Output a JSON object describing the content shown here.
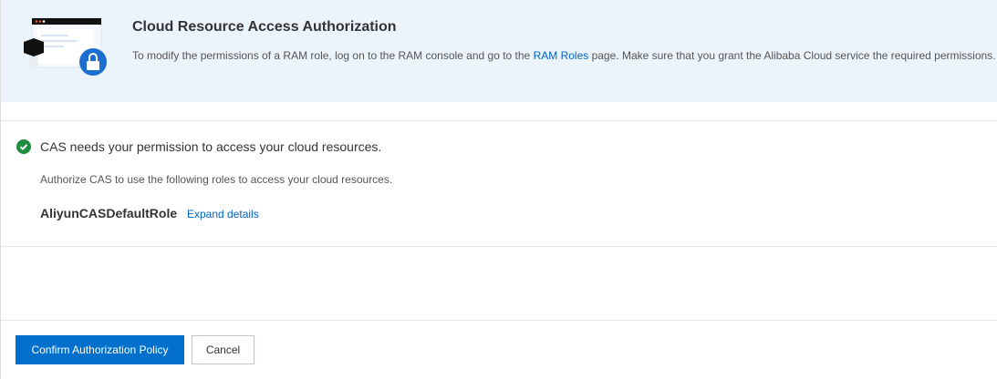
{
  "banner": {
    "title": "Cloud Resource Access Authorization",
    "desc_before": "To modify the permissions of a RAM role, log on to the RAM console and go to the ",
    "link": "RAM Roles",
    "desc_after": " page. Make sure that you grant the Alibaba Cloud service the required permissions."
  },
  "main": {
    "message": "CAS needs your permission to access your cloud resources.",
    "subtext": "Authorize CAS to use the following roles to access your cloud resources.",
    "role_name": "AliyunCASDefaultRole",
    "expand_label": "Expand details"
  },
  "footer": {
    "confirm_label": "Confirm Authorization Policy",
    "cancel_label": "Cancel"
  },
  "colors": {
    "accent": "#0070cc",
    "success": "#1e8e3e",
    "banner_bg": "#ebf3fb"
  }
}
